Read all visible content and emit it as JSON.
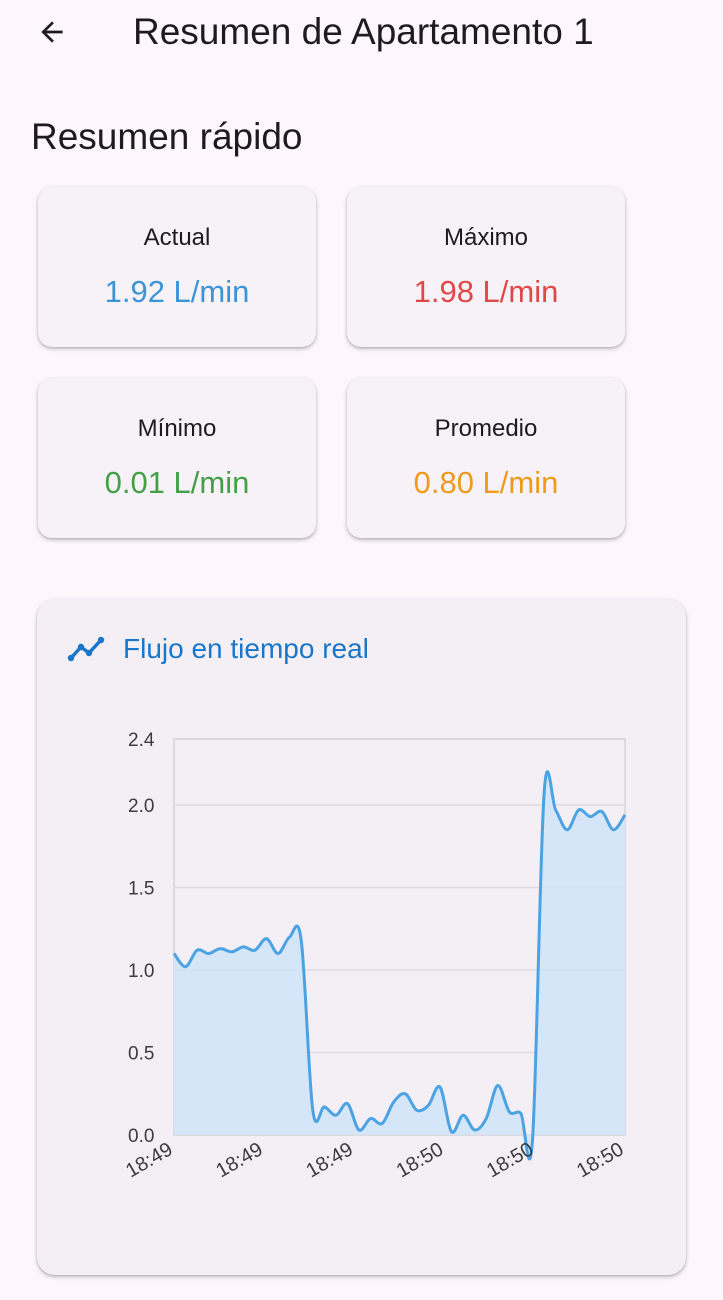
{
  "appbar": {
    "title": "Resumen de Apartamento 1",
    "back_icon": "arrow-back-icon"
  },
  "summary": {
    "title": "Resumen rápido",
    "cards": [
      {
        "label": "Actual",
        "value": "1.92 L/min",
        "color": "#3a94d8"
      },
      {
        "label": "Máximo",
        "value": "1.98 L/min",
        "color": "#e04848"
      },
      {
        "label": "Mínimo",
        "value": "0.01 L/min",
        "color": "#43a047"
      },
      {
        "label": "Promedio",
        "value": "0.80 L/min",
        "color": "#f09a1c"
      }
    ]
  },
  "chart": {
    "title": "Flujo en tiempo real",
    "icon": "trending-up-icon",
    "accent": "#1976c8"
  },
  "chart_data": {
    "type": "area",
    "title": "Flujo en tiempo real",
    "xlabel": "",
    "ylabel": "",
    "ylim": [
      0,
      2.4
    ],
    "yticks": [
      "2.4",
      "2.0",
      "1.5",
      "1.0",
      "0.5",
      "0.0"
    ],
    "xticks": [
      "18:49",
      "18:49",
      "18:49",
      "18:50",
      "18:50",
      "18:50"
    ],
    "grid": true,
    "line_color": "#4ba3e3",
    "fill_color": "#d3e5f8",
    "series": [
      {
        "values": [
          1.1,
          1.02,
          1.12,
          1.1,
          1.13,
          1.11,
          1.14,
          1.12,
          1.19,
          1.1,
          1.2,
          1.18,
          0.15,
          0.17,
          0.12,
          0.19,
          0.03,
          0.1,
          0.07,
          0.2,
          0.25,
          0.15,
          0.18,
          0.29,
          0.02,
          0.12,
          0.03,
          0.1,
          0.3,
          0.14,
          0.13,
          -0.03,
          2.07,
          1.97,
          1.85,
          1.97,
          1.93,
          1.96,
          1.85,
          1.94
        ]
      }
    ]
  }
}
